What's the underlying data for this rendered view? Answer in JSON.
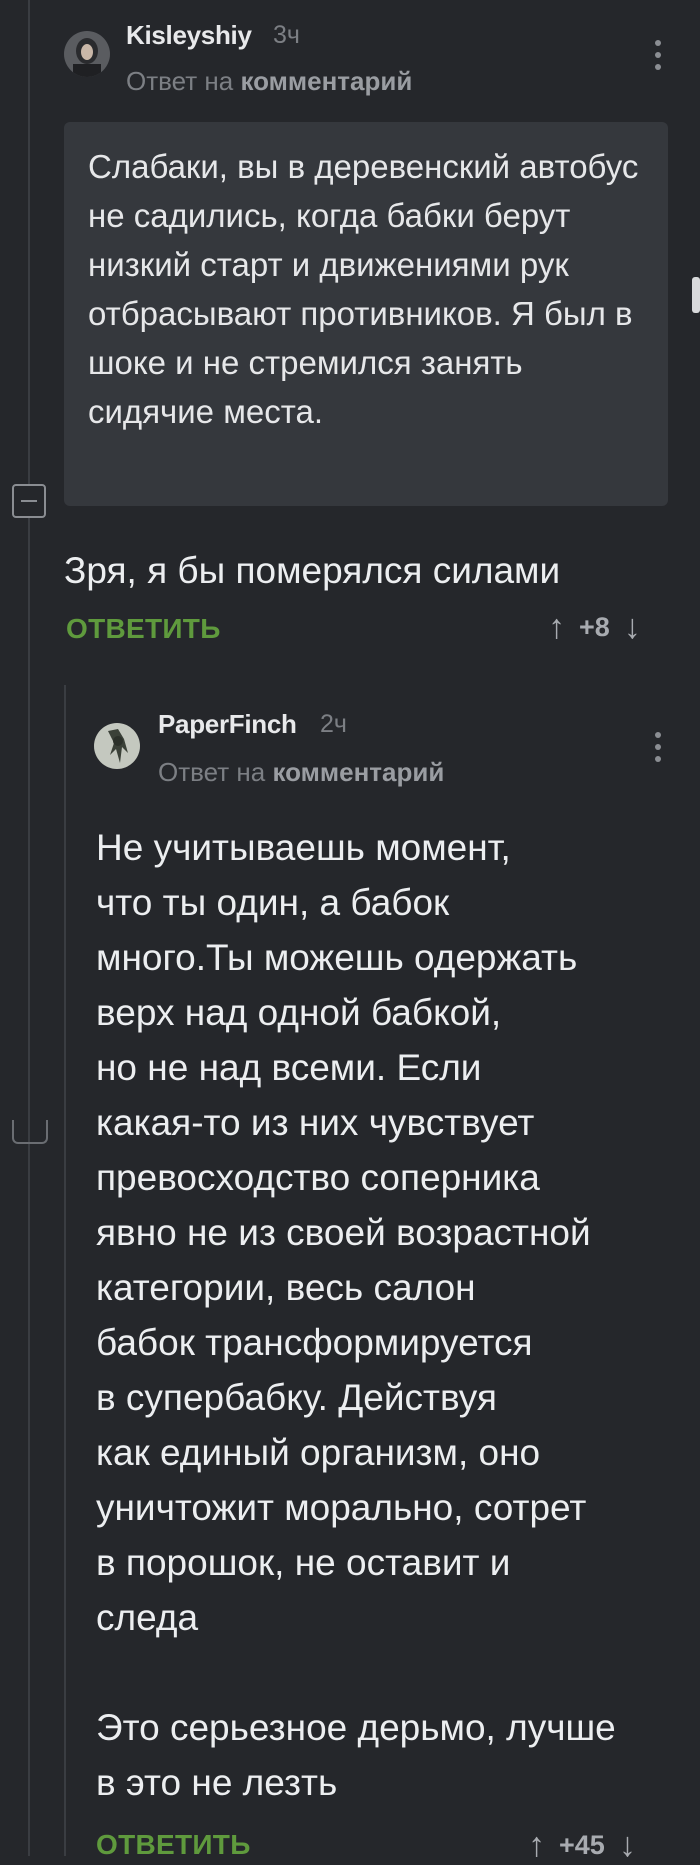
{
  "comment1": {
    "username": "Kisleyshiy",
    "time": "3ч",
    "reply_prefix": "Ответ на",
    "reply_target": "комментарий",
    "quote": "Слабаки, вы в деревенский автобус не садились, когда бабки берут низкий старт и движениями рук отбрасывают противников. Я был в шоке и не стремился занять сидячие места.",
    "text": "Зря, я бы померялся силами",
    "reply_label": "ОТВЕТИТЬ",
    "score": "+8"
  },
  "comment2": {
    "username": "PaperFinch",
    "time": "2ч",
    "reply_prefix": "Ответ на",
    "reply_target": "комментарий",
    "text": "Не учитываешь момент,\nчто ты один, а бабок\nмного.Ты можешь одержать\nверх над одной бабкой,\nно не над всеми. Если\nкакая-то из них чувствует\nпревосходство соперника\nявно не из своей возрастной\nкатегории, весь салон\nбабок трансформируется\nв супербабку. Действуя\nкак единый организм, оно\nуничтожит морально, сотрет\nв порошок, не оставит и\nследа\n\nЭто серьезное дерьмо, лучше\nв это не лезть",
    "reply_label": "ОТВЕТИТЬ",
    "score": "+45"
  },
  "icons": {
    "upvote": "arrow-up-icon",
    "downvote": "arrow-down-icon",
    "more": "more-vertical-icon",
    "collapse": "minus-icon"
  },
  "colors": {
    "background": "#25272b",
    "quote_bg": "#35383d",
    "accent": "#5f9a3d"
  }
}
